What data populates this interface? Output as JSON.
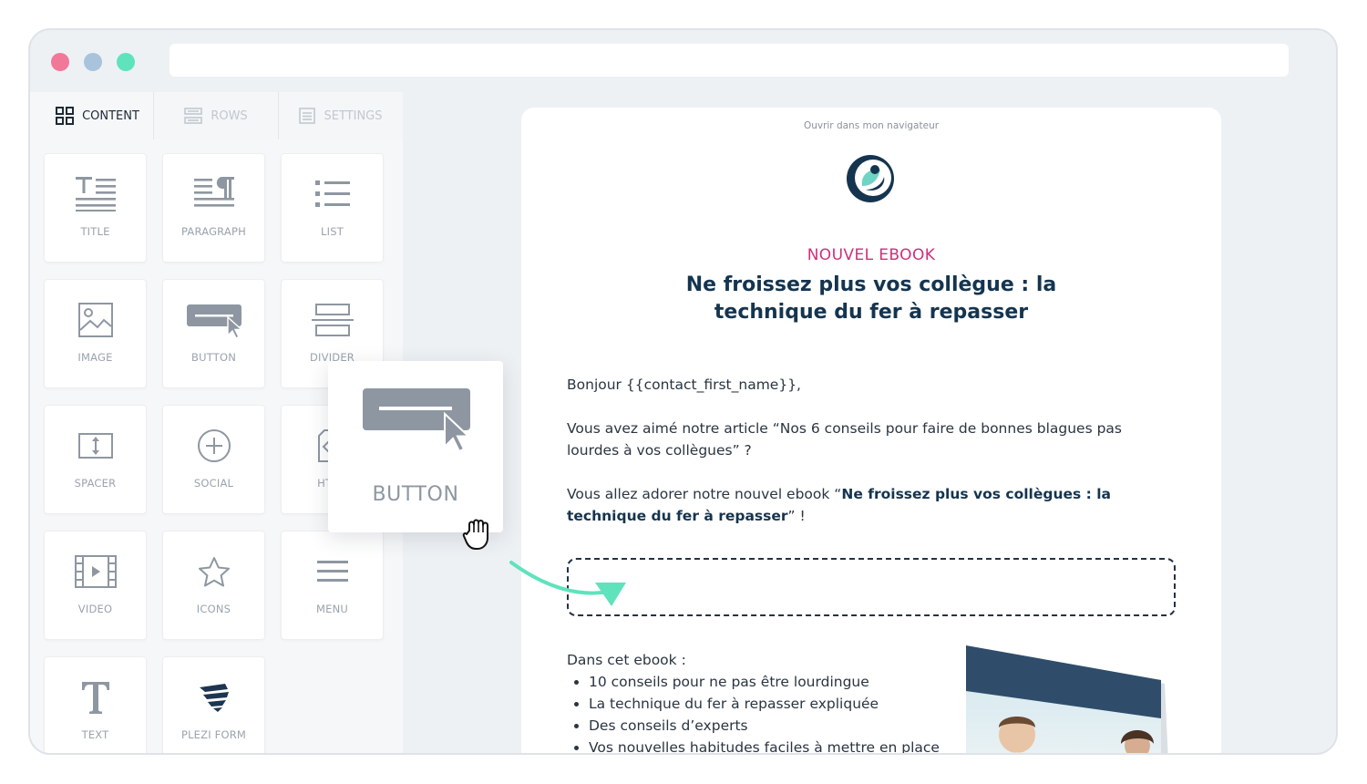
{
  "colors": {
    "accent_pink": "#cf2f7c",
    "navy": "#15344f",
    "teal": "#5fe3bc",
    "window_dot_red": "#f2789a",
    "window_dot_blue": "#a9c3dc",
    "window_dot_green": "#5fe3bc"
  },
  "sidebar": {
    "tabs": [
      {
        "label": "CONTENT",
        "icon": "grid-icon",
        "active": true
      },
      {
        "label": "ROWS",
        "icon": "rows-icon",
        "active": false
      },
      {
        "label": "SETTINGS",
        "icon": "settings-list-icon",
        "active": false
      }
    ],
    "tiles": [
      {
        "label": "TITLE",
        "icon": "title-icon"
      },
      {
        "label": "PARAGRAPH",
        "icon": "paragraph-icon"
      },
      {
        "label": "LIST",
        "icon": "list-icon"
      },
      {
        "label": "IMAGE",
        "icon": "image-icon"
      },
      {
        "label": "BUTTON",
        "icon": "button-icon"
      },
      {
        "label": "DIVIDER",
        "icon": "divider-icon"
      },
      {
        "label": "SPACER",
        "icon": "spacer-icon"
      },
      {
        "label": "SOCIAL",
        "icon": "plus-circle-icon"
      },
      {
        "label": "HTML",
        "icon": "html-icon"
      },
      {
        "label": "VIDEO",
        "icon": "video-icon"
      },
      {
        "label": "ICONS",
        "icon": "star-icon"
      },
      {
        "label": "MENU",
        "icon": "menu-icon"
      },
      {
        "label": "TEXT",
        "icon": "text-icon"
      },
      {
        "label": "PLEZI FORM",
        "icon": "plezi-form-icon"
      }
    ]
  },
  "drag_preview": {
    "label": "BUTTON",
    "icon": "button-icon",
    "cursor": "hand-grab-icon"
  },
  "email": {
    "view_in_browser": "Ouvrir dans mon navigateur",
    "kicker": "NOUVEL EBOOK",
    "headline": "Ne froissez plus vos collègue : la technique du fer à repasser",
    "greeting": "Bonjour {{contact_first_name}},",
    "paragraph1": "Vous avez aimé notre article “Nos 6 conseils pour faire de bonnes blagues pas lourdes à vos collègues” ?",
    "paragraph2_prefix": "Vous allez adorer notre nouvel ebook “",
    "paragraph2_bold": "Ne froissez plus vos collègues : la technique du fer à repasser",
    "paragraph2_suffix": "” !",
    "list_intro": "Dans cet ebook :",
    "list_items": [
      "10 conseils pour ne pas être lourdingue",
      "La technique du fer à repasser expliquée",
      "Des conseils d’experts",
      "Vos nouvelles habitudes faciles à mettre en place"
    ]
  }
}
